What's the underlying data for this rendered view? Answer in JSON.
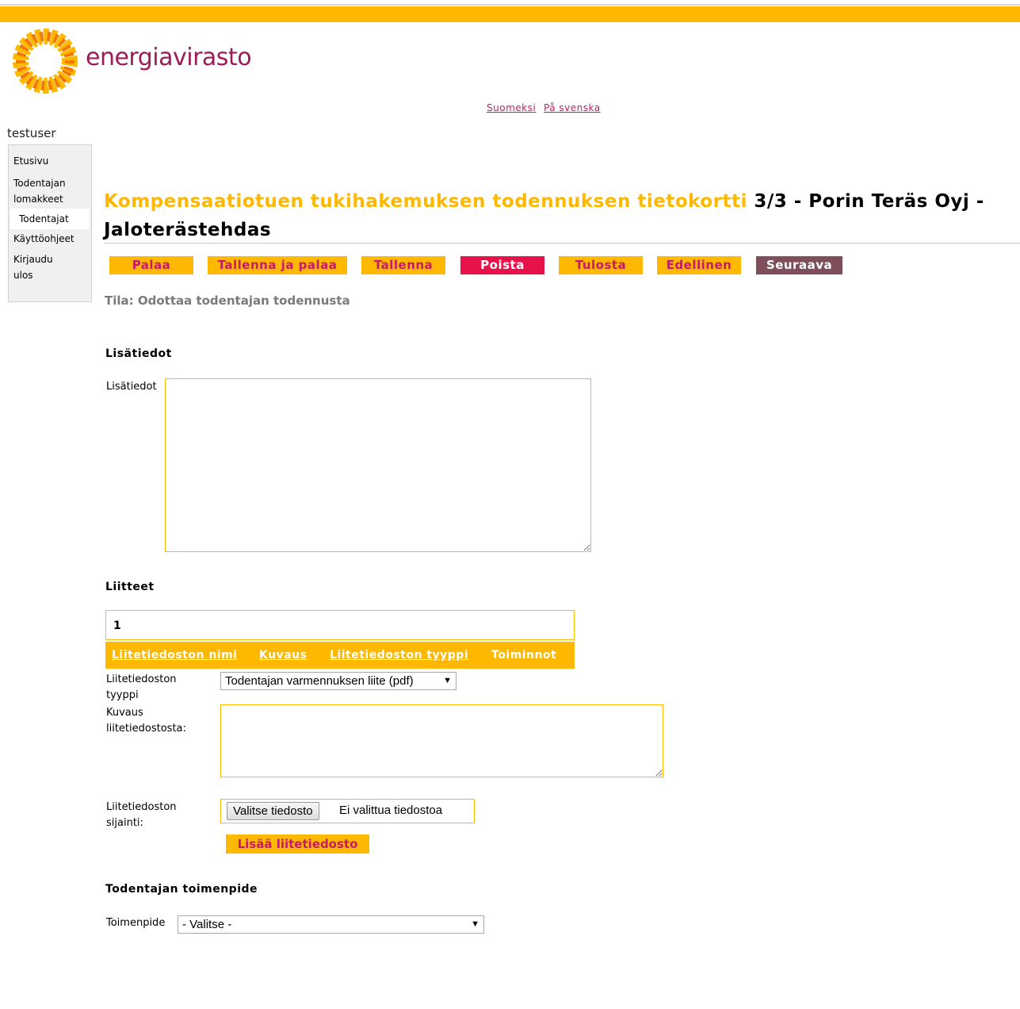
{
  "brand": {
    "name": "energiavirasto",
    "colors": {
      "accent": "#ffb800",
      "brand": "#9b1d57",
      "link": "#c8196a",
      "danger": "#e8124b",
      "next": "#7e4e5a"
    }
  },
  "lang": {
    "fi": "Suomeksi",
    "sv": "På svenska"
  },
  "user": "testuser",
  "sidebar": {
    "items": [
      {
        "label": "Etusivu"
      },
      {
        "label": "Todentajan lomakkeet"
      },
      {
        "label": "Todentajat"
      },
      {
        "label": "Käyttöohjeet"
      },
      {
        "label": "Kirjaudu ulos"
      }
    ]
  },
  "title": {
    "part1": "Kompensaatiotuen tukihakemuksen todennuksen tietokortti",
    "part2": "3/3 - Porin Teräs Oyj - Jaloterästehdas"
  },
  "toolbar": {
    "back": "Palaa",
    "save_back": "Tallenna ja palaa",
    "save": "Tallenna",
    "delete": "Poista",
    "print": "Tulosta",
    "previous": "Edellinen",
    "next": "Seuraava"
  },
  "status": "Tila: Odottaa todentajan todennusta",
  "extra_info": {
    "heading": "Lisätiedot",
    "label": "Lisätiedot",
    "value": ""
  },
  "attachments": {
    "heading": "Liitteet",
    "count": "1",
    "columns": [
      "Liitetiedoston nimi",
      "Kuvaus",
      "Liitetiedoston tyyppi",
      "Toiminnot"
    ],
    "type_label": "Liitetiedoston tyyppi",
    "type_value": "Todentajan varmennuksen liite (pdf)",
    "desc_label": "Kuvaus liitetiedostosta:",
    "location_label": "Liitetiedoston sijainti:",
    "choose_file": "Valitse tiedosto",
    "no_file": "Ei valittua tiedostoa",
    "add_button": "Lisää liitetiedosto"
  },
  "action": {
    "heading": "Todentajan toimenpide",
    "label": "Toimenpide",
    "value": "- Valitse -"
  }
}
